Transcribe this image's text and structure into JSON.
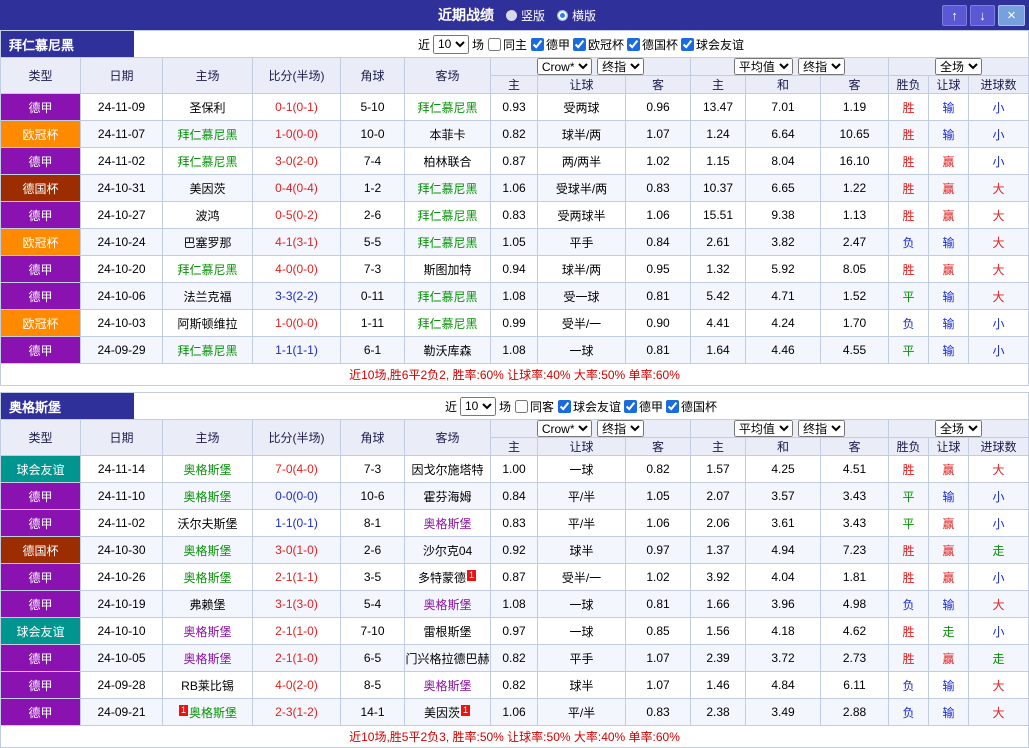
{
  "topbar": {
    "title": "近期战绩",
    "radio_vertical": "竖版",
    "radio_horizontal": "横版",
    "up_icon": "↑",
    "down_icon": "↓",
    "close_icon": "×"
  },
  "labels": {
    "near": "近",
    "count": "10",
    "matches": "场"
  },
  "table_headers": {
    "type": "类型",
    "date": "日期",
    "home": "主场",
    "score": "比分(半场)",
    "corner": "角球",
    "away": "客场",
    "company": "Crow*",
    "final": "终指",
    "average": "平均值",
    "full": "全场",
    "sub": [
      "主",
      "让球",
      "客",
      "主",
      "和",
      "客",
      "胜负",
      "让球",
      "进球数"
    ]
  },
  "type_colors": {
    "德甲": "#8a12b0",
    "欧冠杯": "#ff8a00",
    "德国杯": "#9b2d00",
    "球会友谊": "#00968f"
  },
  "sections": [
    {
      "team": "拜仁慕尼黑",
      "same_label": "同主",
      "leagues": [
        "德甲",
        "欧冠杯",
        "德国杯",
        "球会友谊"
      ],
      "summary": "近10场,胜6平2负2, 胜率:60% 让球率:40% 大率:50% 单率:60%",
      "rows": [
        {
          "type": "德甲",
          "date": "24-11-09",
          "home": "圣保利",
          "home_color": "",
          "score": "0-1(0-1)",
          "score_color": "red",
          "corner": "5-10",
          "away": "拜仁慕尼黑",
          "away_color": "green",
          "odds_home": "0.93",
          "handicap": "受两球",
          "odds_away": "0.96",
          "avg_home": "13.47",
          "avg_draw": "7.01",
          "avg_away": "1.19",
          "result": "胜",
          "result_color": "red",
          "handicap_result": "输",
          "handicap_result_color": "blue",
          "goals": "小",
          "goals_color": "blue"
        },
        {
          "type": "欧冠杯",
          "date": "24-11-07",
          "home": "拜仁慕尼黑",
          "home_color": "green",
          "score": "1-0(0-0)",
          "score_color": "red",
          "corner": "10-0",
          "away": "本菲卡",
          "away_color": "",
          "odds_home": "0.82",
          "handicap": "球半/两",
          "odds_away": "1.07",
          "avg_home": "1.24",
          "avg_draw": "6.64",
          "avg_away": "10.65",
          "result": "胜",
          "result_color": "red",
          "handicap_result": "输",
          "handicap_result_color": "blue",
          "goals": "小",
          "goals_color": "blue"
        },
        {
          "type": "德甲",
          "date": "24-11-02",
          "home": "拜仁慕尼黑",
          "home_color": "green",
          "score": "3-0(2-0)",
          "score_color": "red",
          "corner": "7-4",
          "away": "柏林联合",
          "away_color": "",
          "odds_home": "0.87",
          "handicap": "两/两半",
          "odds_away": "1.02",
          "avg_home": "1.15",
          "avg_draw": "8.04",
          "avg_away": "16.10",
          "result": "胜",
          "result_color": "red",
          "handicap_result": "赢",
          "handicap_result_color": "red",
          "goals": "小",
          "goals_color": "blue"
        },
        {
          "type": "德国杯",
          "date": "24-10-31",
          "home": "美因茨",
          "home_color": "",
          "score": "0-4(0-4)",
          "score_color": "red",
          "corner": "1-2",
          "away": "拜仁慕尼黑",
          "away_color": "green",
          "odds_home": "1.06",
          "handicap": "受球半/两",
          "odds_away": "0.83",
          "avg_home": "10.37",
          "avg_draw": "6.65",
          "avg_away": "1.22",
          "result": "胜",
          "result_color": "red",
          "handicap_result": "赢",
          "handicap_result_color": "red",
          "goals": "大",
          "goals_color": "red"
        },
        {
          "type": "德甲",
          "date": "24-10-27",
          "home": "波鸿",
          "home_color": "",
          "score": "0-5(0-2)",
          "score_color": "red",
          "corner": "2-6",
          "away": "拜仁慕尼黑",
          "away_color": "green",
          "odds_home": "0.83",
          "handicap": "受两球半",
          "odds_away": "1.06",
          "avg_home": "15.51",
          "avg_draw": "9.38",
          "avg_away": "1.13",
          "result": "胜",
          "result_color": "red",
          "handicap_result": "赢",
          "handicap_result_color": "red",
          "goals": "大",
          "goals_color": "red"
        },
        {
          "type": "欧冠杯",
          "date": "24-10-24",
          "home": "巴塞罗那",
          "home_color": "",
          "score": "4-1(3-1)",
          "score_color": "red",
          "corner": "5-5",
          "away": "拜仁慕尼黑",
          "away_color": "green",
          "odds_home": "1.05",
          "handicap": "平手",
          "odds_away": "0.84",
          "avg_home": "2.61",
          "avg_draw": "3.82",
          "avg_away": "2.47",
          "result": "负",
          "result_color": "blue",
          "handicap_result": "输",
          "handicap_result_color": "blue",
          "goals": "大",
          "goals_color": "red"
        },
        {
          "type": "德甲",
          "date": "24-10-20",
          "home": "拜仁慕尼黑",
          "home_color": "green",
          "score": "4-0(0-0)",
          "score_color": "red",
          "corner": "7-3",
          "away": "斯图加特",
          "away_color": "",
          "odds_home": "0.94",
          "handicap": "球半/两",
          "odds_away": "0.95",
          "avg_home": "1.32",
          "avg_draw": "5.92",
          "avg_away": "8.05",
          "result": "胜",
          "result_color": "red",
          "handicap_result": "赢",
          "handicap_result_color": "red",
          "goals": "大",
          "goals_color": "red"
        },
        {
          "type": "德甲",
          "date": "24-10-06",
          "home": "法兰克福",
          "home_color": "",
          "score": "3-3(2-2)",
          "score_color": "blue",
          "corner": "0-11",
          "away": "拜仁慕尼黑",
          "away_color": "green",
          "odds_home": "1.08",
          "handicap": "受一球",
          "odds_away": "0.81",
          "avg_home": "5.42",
          "avg_draw": "4.71",
          "avg_away": "1.52",
          "result": "平",
          "result_color": "green",
          "handicap_result": "输",
          "handicap_result_color": "blue",
          "goals": "大",
          "goals_color": "red"
        },
        {
          "type": "欧冠杯",
          "date": "24-10-03",
          "home": "阿斯顿维拉",
          "home_color": "",
          "score": "1-0(0-0)",
          "score_color": "red",
          "corner": "1-11",
          "away": "拜仁慕尼黑",
          "away_color": "green",
          "odds_home": "0.99",
          "handicap": "受半/一",
          "odds_away": "0.90",
          "avg_home": "4.41",
          "avg_draw": "4.24",
          "avg_away": "1.70",
          "result": "负",
          "result_color": "blue",
          "handicap_result": "输",
          "handicap_result_color": "blue",
          "goals": "小",
          "goals_color": "blue"
        },
        {
          "type": "德甲",
          "date": "24-09-29",
          "home": "拜仁慕尼黑",
          "home_color": "green",
          "score": "1-1(1-1)",
          "score_color": "blue",
          "corner": "6-1",
          "away": "勒沃库森",
          "away_color": "",
          "odds_home": "1.08",
          "handicap": "一球",
          "odds_away": "0.81",
          "avg_home": "1.64",
          "avg_draw": "4.46",
          "avg_away": "4.55",
          "result": "平",
          "result_color": "green",
          "handicap_result": "输",
          "handicap_result_color": "blue",
          "goals": "小",
          "goals_color": "blue"
        }
      ]
    },
    {
      "team": "奥格斯堡",
      "same_label": "同客",
      "leagues": [
        "球会友谊",
        "德甲",
        "德国杯"
      ],
      "summary": "近10场,胜5平2负3, 胜率:50% 让球率:50% 大率:40% 单率:60%",
      "rows": [
        {
          "type": "球会友谊",
          "date": "24-11-14",
          "home": "奥格斯堡",
          "home_color": "green",
          "score": "7-0(4-0)",
          "score_color": "red",
          "corner": "7-3",
          "away": "因戈尔施塔特",
          "away_color": "",
          "odds_home": "1.00",
          "handicap": "一球",
          "odds_away": "0.82",
          "avg_home": "1.57",
          "avg_draw": "4.25",
          "avg_away": "4.51",
          "result": "胜",
          "result_color": "red",
          "handicap_result": "赢",
          "handicap_result_color": "red",
          "goals": "大",
          "goals_color": "red"
        },
        {
          "type": "德甲",
          "date": "24-11-10",
          "home": "奥格斯堡",
          "home_color": "green",
          "score": "0-0(0-0)",
          "score_color": "blue",
          "corner": "10-6",
          "away": "霍芬海姆",
          "away_color": "",
          "odds_home": "0.84",
          "handicap": "平/半",
          "odds_away": "1.05",
          "avg_home": "2.07",
          "avg_draw": "3.57",
          "avg_away": "3.43",
          "result": "平",
          "result_color": "green",
          "handicap_result": "输",
          "handicap_result_color": "blue",
          "goals": "小",
          "goals_color": "blue"
        },
        {
          "type": "德甲",
          "date": "24-11-02",
          "home": "沃尔夫斯堡",
          "home_color": "",
          "score": "1-1(0-1)",
          "score_color": "blue",
          "corner": "8-1",
          "away": "奥格斯堡",
          "away_color": "purple",
          "odds_home": "0.83",
          "handicap": "平/半",
          "odds_away": "1.06",
          "avg_home": "2.06",
          "avg_draw": "3.61",
          "avg_away": "3.43",
          "result": "平",
          "result_color": "green",
          "handicap_result": "赢",
          "handicap_result_color": "red",
          "goals": "小",
          "goals_color": "blue"
        },
        {
          "type": "德国杯",
          "date": "24-10-30",
          "home": "奥格斯堡",
          "home_color": "green",
          "score": "3-0(1-0)",
          "score_color": "red",
          "corner": "2-6",
          "away": "沙尔克04",
          "away_color": "",
          "odds_home": "0.92",
          "handicap": "球半",
          "odds_away": "0.97",
          "avg_home": "1.37",
          "avg_draw": "4.94",
          "avg_away": "7.23",
          "result": "胜",
          "result_color": "red",
          "handicap_result": "赢",
          "handicap_result_color": "red",
          "goals": "走",
          "goals_color": "green"
        },
        {
          "type": "德甲",
          "date": "24-10-26",
          "home": "奥格斯堡",
          "home_color": "green",
          "score": "2-1(1-1)",
          "score_color": "red",
          "corner": "3-5",
          "away": "多特蒙德",
          "away_color": "",
          "away_badge": "1",
          "odds_home": "0.87",
          "handicap": "受半/一",
          "odds_away": "1.02",
          "avg_home": "3.92",
          "avg_draw": "4.04",
          "avg_away": "1.81",
          "result": "胜",
          "result_color": "red",
          "handicap_result": "赢",
          "handicap_result_color": "red",
          "goals": "小",
          "goals_color": "blue"
        },
        {
          "type": "德甲",
          "date": "24-10-19",
          "home": "弗赖堡",
          "home_color": "",
          "score": "3-1(3-0)",
          "score_color": "red",
          "corner": "5-4",
          "away": "奥格斯堡",
          "away_color": "purple",
          "odds_home": "1.08",
          "handicap": "一球",
          "odds_away": "0.81",
          "avg_home": "1.66",
          "avg_draw": "3.96",
          "avg_away": "4.98",
          "result": "负",
          "result_color": "blue",
          "handicap_result": "输",
          "handicap_result_color": "blue",
          "goals": "大",
          "goals_color": "red"
        },
        {
          "type": "球会友谊",
          "date": "24-10-10",
          "home": "奥格斯堡",
          "home_color": "purple",
          "score": "2-1(1-0)",
          "score_color": "red",
          "corner": "7-10",
          "away": "雷根斯堡",
          "away_color": "",
          "odds_home": "0.97",
          "handicap": "一球",
          "odds_away": "0.85",
          "avg_home": "1.56",
          "avg_draw": "4.18",
          "avg_away": "4.62",
          "result": "胜",
          "result_color": "red",
          "handicap_result": "走",
          "handicap_result_color": "green",
          "goals": "小",
          "goals_color": "blue"
        },
        {
          "type": "德甲",
          "date": "24-10-05",
          "home": "奥格斯堡",
          "home_color": "purple",
          "score": "2-1(1-0)",
          "score_color": "red",
          "corner": "6-5",
          "away": "门兴格拉德巴赫",
          "away_color": "",
          "odds_home": "0.82",
          "handicap": "平手",
          "odds_away": "1.07",
          "avg_home": "2.39",
          "avg_draw": "3.72",
          "avg_away": "2.73",
          "result": "胜",
          "result_color": "red",
          "handicap_result": "赢",
          "handicap_result_color": "red",
          "goals": "走",
          "goals_color": "green"
        },
        {
          "type": "德甲",
          "date": "24-09-28",
          "home": "RB莱比锡",
          "home_color": "",
          "score": "4-0(2-0)",
          "score_color": "red",
          "corner": "8-5",
          "away": "奥格斯堡",
          "away_color": "purple",
          "odds_home": "0.82",
          "handicap": "球半",
          "odds_away": "1.07",
          "avg_home": "1.46",
          "avg_draw": "4.84",
          "avg_away": "6.11",
          "result": "负",
          "result_color": "blue",
          "handicap_result": "输",
          "handicap_result_color": "blue",
          "goals": "大",
          "goals_color": "red"
        },
        {
          "type": "德甲",
          "date": "24-09-21",
          "home": "奥格斯堡",
          "home_color": "green",
          "home_badge": "1",
          "score": "2-3(1-2)",
          "score_color": "red",
          "corner": "14-1",
          "away": "美因茨",
          "away_color": "",
          "away_badge": "1",
          "odds_home": "1.06",
          "handicap": "平/半",
          "odds_away": "0.83",
          "avg_home": "2.38",
          "avg_draw": "3.49",
          "avg_away": "2.88",
          "result": "负",
          "result_color": "blue",
          "handicap_result": "输",
          "handicap_result_color": "blue",
          "goals": "大",
          "goals_color": "red"
        }
      ]
    }
  ]
}
